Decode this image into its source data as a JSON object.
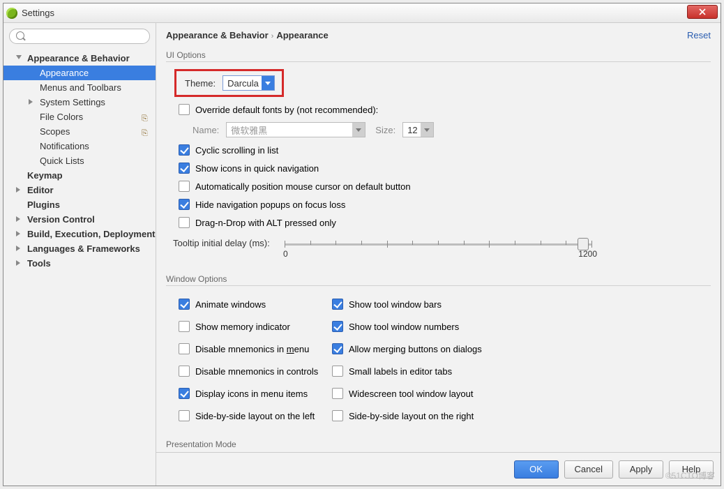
{
  "window": {
    "title": "Settings"
  },
  "sidebar": {
    "search_placeholder": "",
    "items": [
      {
        "label": "Appearance & Behavior",
        "bold": true,
        "arrow": "down",
        "lvl": 1
      },
      {
        "label": "Appearance",
        "lvl": 2,
        "selected": true
      },
      {
        "label": "Menus and Toolbars",
        "lvl": 2
      },
      {
        "label": "System Settings",
        "lvl": 2,
        "arrow": "right"
      },
      {
        "label": "File Colors",
        "lvl": 2,
        "tag": "⎘"
      },
      {
        "label": "Scopes",
        "lvl": 2,
        "tag": "⎘"
      },
      {
        "label": "Notifications",
        "lvl": 2
      },
      {
        "label": "Quick Lists",
        "lvl": 2
      },
      {
        "label": "Keymap",
        "bold": true,
        "lvl": 1
      },
      {
        "label": "Editor",
        "bold": true,
        "lvl": 1,
        "arrow": "right"
      },
      {
        "label": "Plugins",
        "bold": true,
        "lvl": 1
      },
      {
        "label": "Version Control",
        "bold": true,
        "lvl": 1,
        "arrow": "right"
      },
      {
        "label": "Build, Execution, Deployment",
        "bold": true,
        "lvl": 1,
        "arrow": "right"
      },
      {
        "label": "Languages & Frameworks",
        "bold": true,
        "lvl": 1,
        "arrow": "right"
      },
      {
        "label": "Tools",
        "bold": true,
        "lvl": 1,
        "arrow": "right"
      }
    ]
  },
  "header": {
    "crumb1": "Appearance & Behavior",
    "crumb2": "Appearance",
    "reset": "Reset"
  },
  "ui_options": {
    "title": "UI Options",
    "theme_label": "Theme:",
    "theme_value": "Darcula",
    "override_fonts": "Override default fonts by (not recommended):",
    "name_label": "Name:",
    "name_value": "微软雅黑",
    "size_label": "Size:",
    "size_value": "12",
    "cyclic": "Cyclic scrolling in list",
    "quick_nav": "Show icons in quick navigation",
    "auto_mouse": "Automatically position mouse cursor on default button",
    "hide_nav": "Hide navigation popups on focus loss",
    "dnd_alt": "Drag-n-Drop with ALT pressed only",
    "tooltip_label": "Tooltip initial delay (ms):",
    "slider_min": "0",
    "slider_max": "1200"
  },
  "window_options": {
    "title": "Window Options",
    "c1": [
      "Animate windows",
      "Show memory indicator",
      "Disable mnemonics in menu",
      "Disable mnemonics in controls",
      "Display icons in menu items",
      "Side-by-side layout on the left"
    ],
    "c1_checked": [
      true,
      false,
      false,
      false,
      true,
      false
    ],
    "c2": [
      "Show tool window bars",
      "Show tool window numbers",
      "Allow merging buttons on dialogs",
      "Small labels in editor tabs",
      "Widescreen tool window layout",
      "Side-by-side layout on the right"
    ],
    "c2_checked": [
      true,
      true,
      true,
      false,
      false,
      false
    ]
  },
  "presentation": {
    "title": "Presentation Mode"
  },
  "footer": {
    "ok": "OK",
    "cancel": "Cancel",
    "apply": "Apply",
    "help": "Help"
  },
  "watermark": "©51CTO博客"
}
